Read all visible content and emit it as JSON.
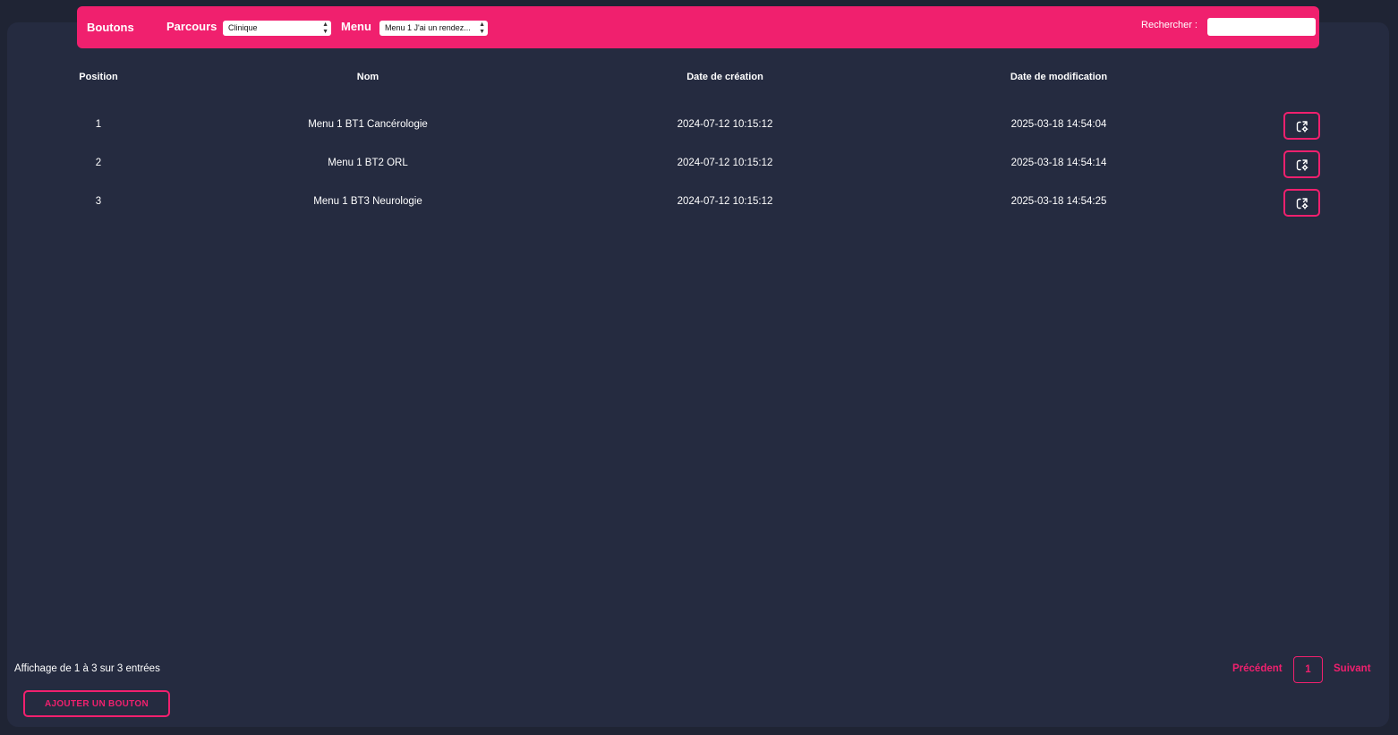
{
  "header": {
    "title": "Boutons",
    "parcours_label": "Parcours",
    "parcours_value": "Clinique",
    "menu_label": "Menu",
    "menu_value": "Menu 1 J'ai un rendez...",
    "search_label": "Rechercher :",
    "search_value": ""
  },
  "table": {
    "columns": [
      "Position",
      "Nom",
      "Date de création",
      "Date de modification"
    ],
    "rows": [
      {
        "position": "1",
        "name": "Menu 1 BT1 Cancérologie",
        "created": "2024-07-12 10:15:12",
        "modified": "2025-03-18 14:54:04",
        "action_icon": "edit-settings-icon"
      },
      {
        "position": "2",
        "name": "Menu 1 BT2 ORL",
        "created": "2024-07-12 10:15:12",
        "modified": "2025-03-18 14:54:14",
        "action_icon": "edit-settings-icon"
      },
      {
        "position": "3",
        "name": "Menu 1 BT3 Neurologie",
        "created": "2024-07-12 10:15:12",
        "modified": "2025-03-18 14:54:25",
        "action_icon": "edit-settings-icon"
      }
    ]
  },
  "footer": {
    "info": "Affichage de 1 à 3 sur 3 entrées",
    "previous": "Précédent",
    "page": "1",
    "next": "Suivant",
    "add_button": "AJOUTER UN BOUTON"
  },
  "colors": {
    "accent": "#f0206e",
    "background": "#1f2434",
    "panel": "#252b40"
  }
}
